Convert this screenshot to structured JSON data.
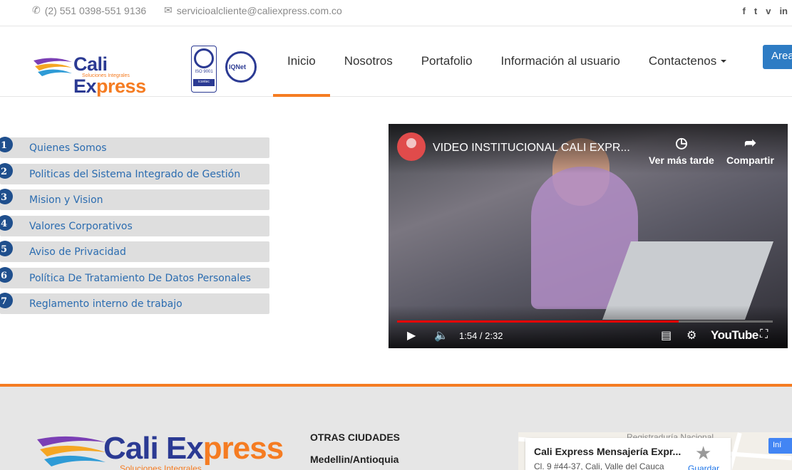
{
  "topbar": {
    "phone": "(2) 551 0398-551 9136",
    "email": "servicioalcliente@caliexpress.com.co",
    "social": [
      "f",
      "t",
      "v",
      "in"
    ]
  },
  "header": {
    "logo_cali": "Cali Ex",
    "logo_press": "press",
    "logo_sub": "Soluciones Integrales",
    "cert_iso": "ISO 9001",
    "cert_icontec": "icontec",
    "cert_iqnet": "IQNet",
    "nav": [
      {
        "label": "Inicio",
        "active": true
      },
      {
        "label": "Nosotros"
      },
      {
        "label": "Portafolio"
      },
      {
        "label": "Información al usuario"
      },
      {
        "label": "Contactenos"
      }
    ],
    "area_button": "Area"
  },
  "menu": [
    {
      "num": "1",
      "label": "Quienes Somos"
    },
    {
      "num": "2",
      "label": "Politicas del Sistema Integrado de Gestión"
    },
    {
      "num": "3",
      "label": "Mision y Vision"
    },
    {
      "num": "4",
      "label": "Valores Corporativos"
    },
    {
      "num": "5",
      "label": "Aviso de Privacidad"
    },
    {
      "num": "6",
      "label": "Política De Tratamiento De Datos Personales"
    },
    {
      "num": "7",
      "label": "Reglamento interno de trabajo"
    }
  ],
  "video": {
    "title": "VIDEO INSTITUCIONAL CALI EXPR...",
    "watch_later": "Ver más tarde",
    "share": "Compartir",
    "time": "1:54 / 2:32",
    "progress": 0.75,
    "brand": "YouTube"
  },
  "footer": {
    "logo_cali": "Cali Ex",
    "logo_press": "press",
    "logo_sub": "Soluciones Integrales",
    "cities_heading": "OTRAS CIUDADES",
    "city": "Medellin/Antioquia",
    "map": {
      "place": "Cali Express Mensajería Expr...",
      "address": "Cl. 9 #44-37, Cali, Valle del Cauca",
      "save": "Guardar",
      "registry": "Registraduría Nacional",
      "button": "Iní"
    }
  },
  "colors": {
    "accent": "#f57c22",
    "brand_blue": "#2b3a93",
    "link_blue": "#2b6cb0"
  }
}
